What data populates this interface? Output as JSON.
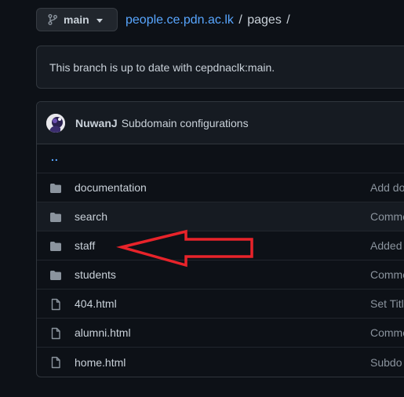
{
  "branch": {
    "label": "main",
    "icon": "git-branch-icon"
  },
  "breadcrumb": {
    "repo": "people.ce.pdn.ac.lk",
    "separator": "/",
    "folder": "pages",
    "trailing": "/"
  },
  "status": {
    "text": "This branch is up to date with cepdnaclk:main."
  },
  "commit": {
    "author": "NuwanJ",
    "message": "Subdomain configurations"
  },
  "parent_link": "..",
  "files": [
    {
      "type": "folder",
      "name": "documentation",
      "message": "Add do"
    },
    {
      "type": "folder",
      "name": "search",
      "message": "Comme"
    },
    {
      "type": "folder",
      "name": "staff",
      "message": "Added"
    },
    {
      "type": "folder",
      "name": "students",
      "message": "Comme"
    },
    {
      "type": "file",
      "name": "404.html",
      "message": "Set Titl"
    },
    {
      "type": "file",
      "name": "alumni.html",
      "message": "Comme"
    },
    {
      "type": "file",
      "name": "home.html",
      "message": "Subdo"
    }
  ],
  "colors": {
    "background": "#0d1117",
    "link": "#58a6ff",
    "muted": "#8b949e",
    "annotation_arrow": "#e8232a"
  }
}
